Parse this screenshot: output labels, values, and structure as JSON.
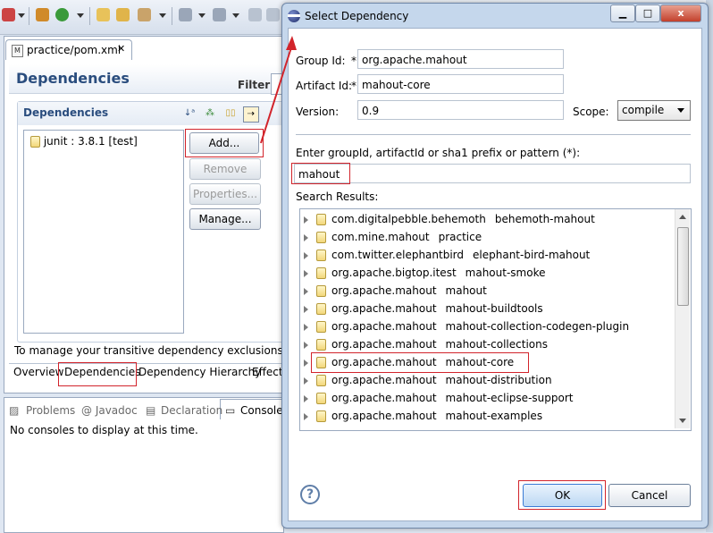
{
  "editor": {
    "tab_label": "practice/pom.xml",
    "tab_icon_letter": "M",
    "form_title": "Dependencies",
    "filter_label": "Filter:",
    "section_title": "Dependencies",
    "dependency_items": [
      "junit : 3.8.1 [test]"
    ],
    "buttons": {
      "add": "Add...",
      "remove": "Remove",
      "properties": "Properties...",
      "manage": "Manage..."
    },
    "manage_text": "To manage your transitive dependency exclusions,",
    "bottom_tabs": [
      "Overview",
      "Dependencies",
      "Dependency Hierarchy",
      "Effecti"
    ]
  },
  "views": {
    "tabs": [
      "Problems",
      "@ Javadoc",
      "Declaration",
      "Console"
    ],
    "console_message": "No consoles to display at this time."
  },
  "dialog": {
    "title": "Select Dependency",
    "group_id_label": "Group Id:",
    "group_id_value": "org.apache.mahout",
    "artifact_id_label": "Artifact Id:",
    "artifact_id_value": "mahout-core",
    "version_label": "Version:",
    "version_value": "0.9",
    "scope_label": "Scope:",
    "scope_value": "compile",
    "required_marker": "*",
    "search_prompt": "Enter groupId, artifactId or sha1 prefix or pattern (*):",
    "search_value": "mahout",
    "results_label": "Search Results:",
    "results": [
      {
        "group": "com.digitalpebble.behemoth",
        "artifact": "behemoth-mahout"
      },
      {
        "group": "com.mine.mahout",
        "artifact": "practice"
      },
      {
        "group": "com.twitter.elephantbird",
        "artifact": "elephant-bird-mahout"
      },
      {
        "group": "org.apache.bigtop.itest",
        "artifact": "mahout-smoke"
      },
      {
        "group": "org.apache.mahout",
        "artifact": "mahout"
      },
      {
        "group": "org.apache.mahout",
        "artifact": "mahout-buildtools"
      },
      {
        "group": "org.apache.mahout",
        "artifact": "mahout-collection-codegen-plugin"
      },
      {
        "group": "org.apache.mahout",
        "artifact": "mahout-collections"
      },
      {
        "group": "org.apache.mahout",
        "artifact": "mahout-core"
      },
      {
        "group": "org.apache.mahout",
        "artifact": "mahout-distribution"
      },
      {
        "group": "org.apache.mahout",
        "artifact": "mahout-eclipse-support"
      },
      {
        "group": "org.apache.mahout",
        "artifact": "mahout-examples"
      }
    ],
    "ok_label": "OK",
    "cancel_label": "Cancel",
    "help_glyph": "?",
    "caption_buttons": {
      "minimize": "▁",
      "maximize": "□",
      "close": "x"
    }
  },
  "colors": {
    "highlight": "#d2242b",
    "title_blue": "#2a4d7e"
  }
}
